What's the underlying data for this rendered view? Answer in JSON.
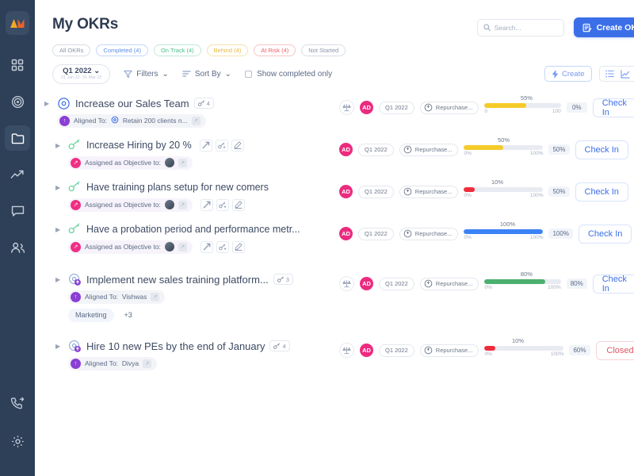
{
  "sidebar": {
    "logo_name": "app-logo",
    "items": [
      {
        "name": "dashboard",
        "icon": "grid-icon",
        "active": false
      },
      {
        "name": "goals",
        "icon": "target-icon",
        "active": false
      },
      {
        "name": "folders",
        "icon": "folder-icon",
        "active": true
      },
      {
        "name": "analytics",
        "icon": "trending-up-icon",
        "active": false
      },
      {
        "name": "messages",
        "icon": "chat-bubble-icon",
        "active": false
      },
      {
        "name": "people",
        "icon": "people-icon",
        "active": false
      }
    ],
    "bottom_items": [
      {
        "name": "support-call",
        "icon": "phone-forward-icon"
      },
      {
        "name": "settings",
        "icon": "gear-icon"
      }
    ]
  },
  "header": {
    "title": "My OKRs",
    "search_placeholder": "Search...",
    "create_okr_label": "Create OKR"
  },
  "filters": {
    "pills": [
      {
        "label": "All OKRs",
        "color": "#8b95a8",
        "border": "#d8dde6"
      },
      {
        "label": "Completed (4)",
        "color": "#5b8def",
        "border": "#c3d6fb"
      },
      {
        "label": "On Track (4)",
        "color": "#49c08a",
        "border": "#bfe9d6"
      },
      {
        "label": "Behind (4)",
        "color": "#e9b93c",
        "border": "#f6e2ad"
      },
      {
        "label": "At Risk (4)",
        "color": "#ef5d68",
        "border": "#f8c3c7"
      },
      {
        "label": "Not Started",
        "color": "#8b95a8",
        "border": "#d8dde6"
      }
    ]
  },
  "toolbar": {
    "quarter_label": "Q1 2022",
    "quarter_dates": "01 Jan 22- 31 Mar 22",
    "filters_label": "Filters",
    "sort_label": "Sort By",
    "show_completed_label": "Show completed only",
    "create_label": "Create",
    "views": [
      "list-view-icon",
      "chart-view-icon",
      "tree-view-icon"
    ]
  },
  "okrs": [
    {
      "title": "Increase our Sales Team",
      "type": "objective",
      "kr_count": "4",
      "align_label": "Aligned To:",
      "align_value": "Retain 200 clients n...",
      "align_kind": "aligned",
      "align_has_target_icon": true,
      "owner": "AD",
      "cycle": "Q1 2022",
      "tag": "Repurchase...",
      "progress_pct": 55,
      "progress_label": "55%",
      "range_start": "0",
      "range_end": "100",
      "bar_color": "#f5cb29",
      "badge": "0%",
      "action": "Check In",
      "action_state": "checkin",
      "show_scale": true,
      "tags": [],
      "mini_actions": false
    },
    {
      "title": "Increase Hiring by 20 %",
      "type": "keyresult",
      "kr_count": null,
      "align_label": "Assigned as Objective to:",
      "align_value": "",
      "align_kind": "assigned",
      "align_has_avatar": true,
      "owner": "AD",
      "cycle": "Q1 2022",
      "tag": "Repurchase...",
      "progress_pct": 50,
      "progress_label": "50%",
      "range_start": "0%",
      "range_end": "100%",
      "bar_color": "#f5cb29",
      "badge": "50%",
      "action": "Check In",
      "action_state": "checkin",
      "show_scale": false,
      "tags": [],
      "mini_actions": "title"
    },
    {
      "title": "Have training plans setup for new comers",
      "type": "keyresult",
      "kr_count": null,
      "align_label": "Assigned as Objective to:",
      "align_value": "",
      "align_kind": "assigned",
      "align_has_avatar": true,
      "owner": "AD",
      "cycle": "Q1 2022",
      "tag": "Repurchase...",
      "progress_pct": 10,
      "progress_label": "10%",
      "range_start": "0%",
      "range_end": "100%",
      "bar_color": "#ef2d3d",
      "badge": "50%",
      "action": "Check In",
      "action_state": "checkin",
      "show_scale": false,
      "tags": [],
      "mini_actions": "chip"
    },
    {
      "title": "Have a probation period and performance metr...",
      "type": "keyresult",
      "kr_count": null,
      "align_label": "Assigned as Objective to:",
      "align_value": "",
      "align_kind": "assigned",
      "align_has_avatar": true,
      "owner": "AD",
      "cycle": "Q1 2022",
      "tag": "Repurchase...",
      "progress_pct": 100,
      "progress_label": "100%",
      "range_start": "0%",
      "range_end": "100%",
      "bar_color": "#3b82f6",
      "badge": "100%",
      "action": "Check In",
      "action_state": "checkin",
      "show_scale": false,
      "tags": [],
      "mini_actions": "chip"
    },
    {
      "title": "Implement new sales training platform...",
      "type": "objective-alt",
      "kr_count": "3",
      "align_label": "Aligned To:",
      "align_value": "Vishwas",
      "align_kind": "aligned",
      "owner": "AD",
      "cycle": "Q1 2022",
      "tag": "Repurchase...",
      "progress_pct": 80,
      "progress_label": "80%",
      "range_start": "0%",
      "range_end": "100%",
      "bar_color": "#4caf6e",
      "badge": "80%",
      "action": "Check In",
      "action_state": "checkin",
      "show_scale": true,
      "tags": [
        "Marketing",
        "+3"
      ],
      "mini_actions": false
    },
    {
      "title": "Hire 10 new PEs by the end of January",
      "type": "objective-alt",
      "kr_count": "4",
      "align_label": "Aligned To:",
      "align_value": "Divya",
      "align_kind": "aligned",
      "owner": "AD",
      "cycle": "Q1 2022",
      "tag": "Repurchase...",
      "progress_pct": 10,
      "progress_label": "10%",
      "range_start": "0%",
      "range_end": "100%",
      "bar_color": "#ef2d3d",
      "badge": "60%",
      "action": "Closed",
      "action_state": "closed",
      "show_scale": true,
      "tags": [],
      "mini_actions": false
    }
  ],
  "colors": {
    "accent": "#3b6fe8",
    "sidebar": "#2e4058",
    "danger": "#e35561"
  }
}
